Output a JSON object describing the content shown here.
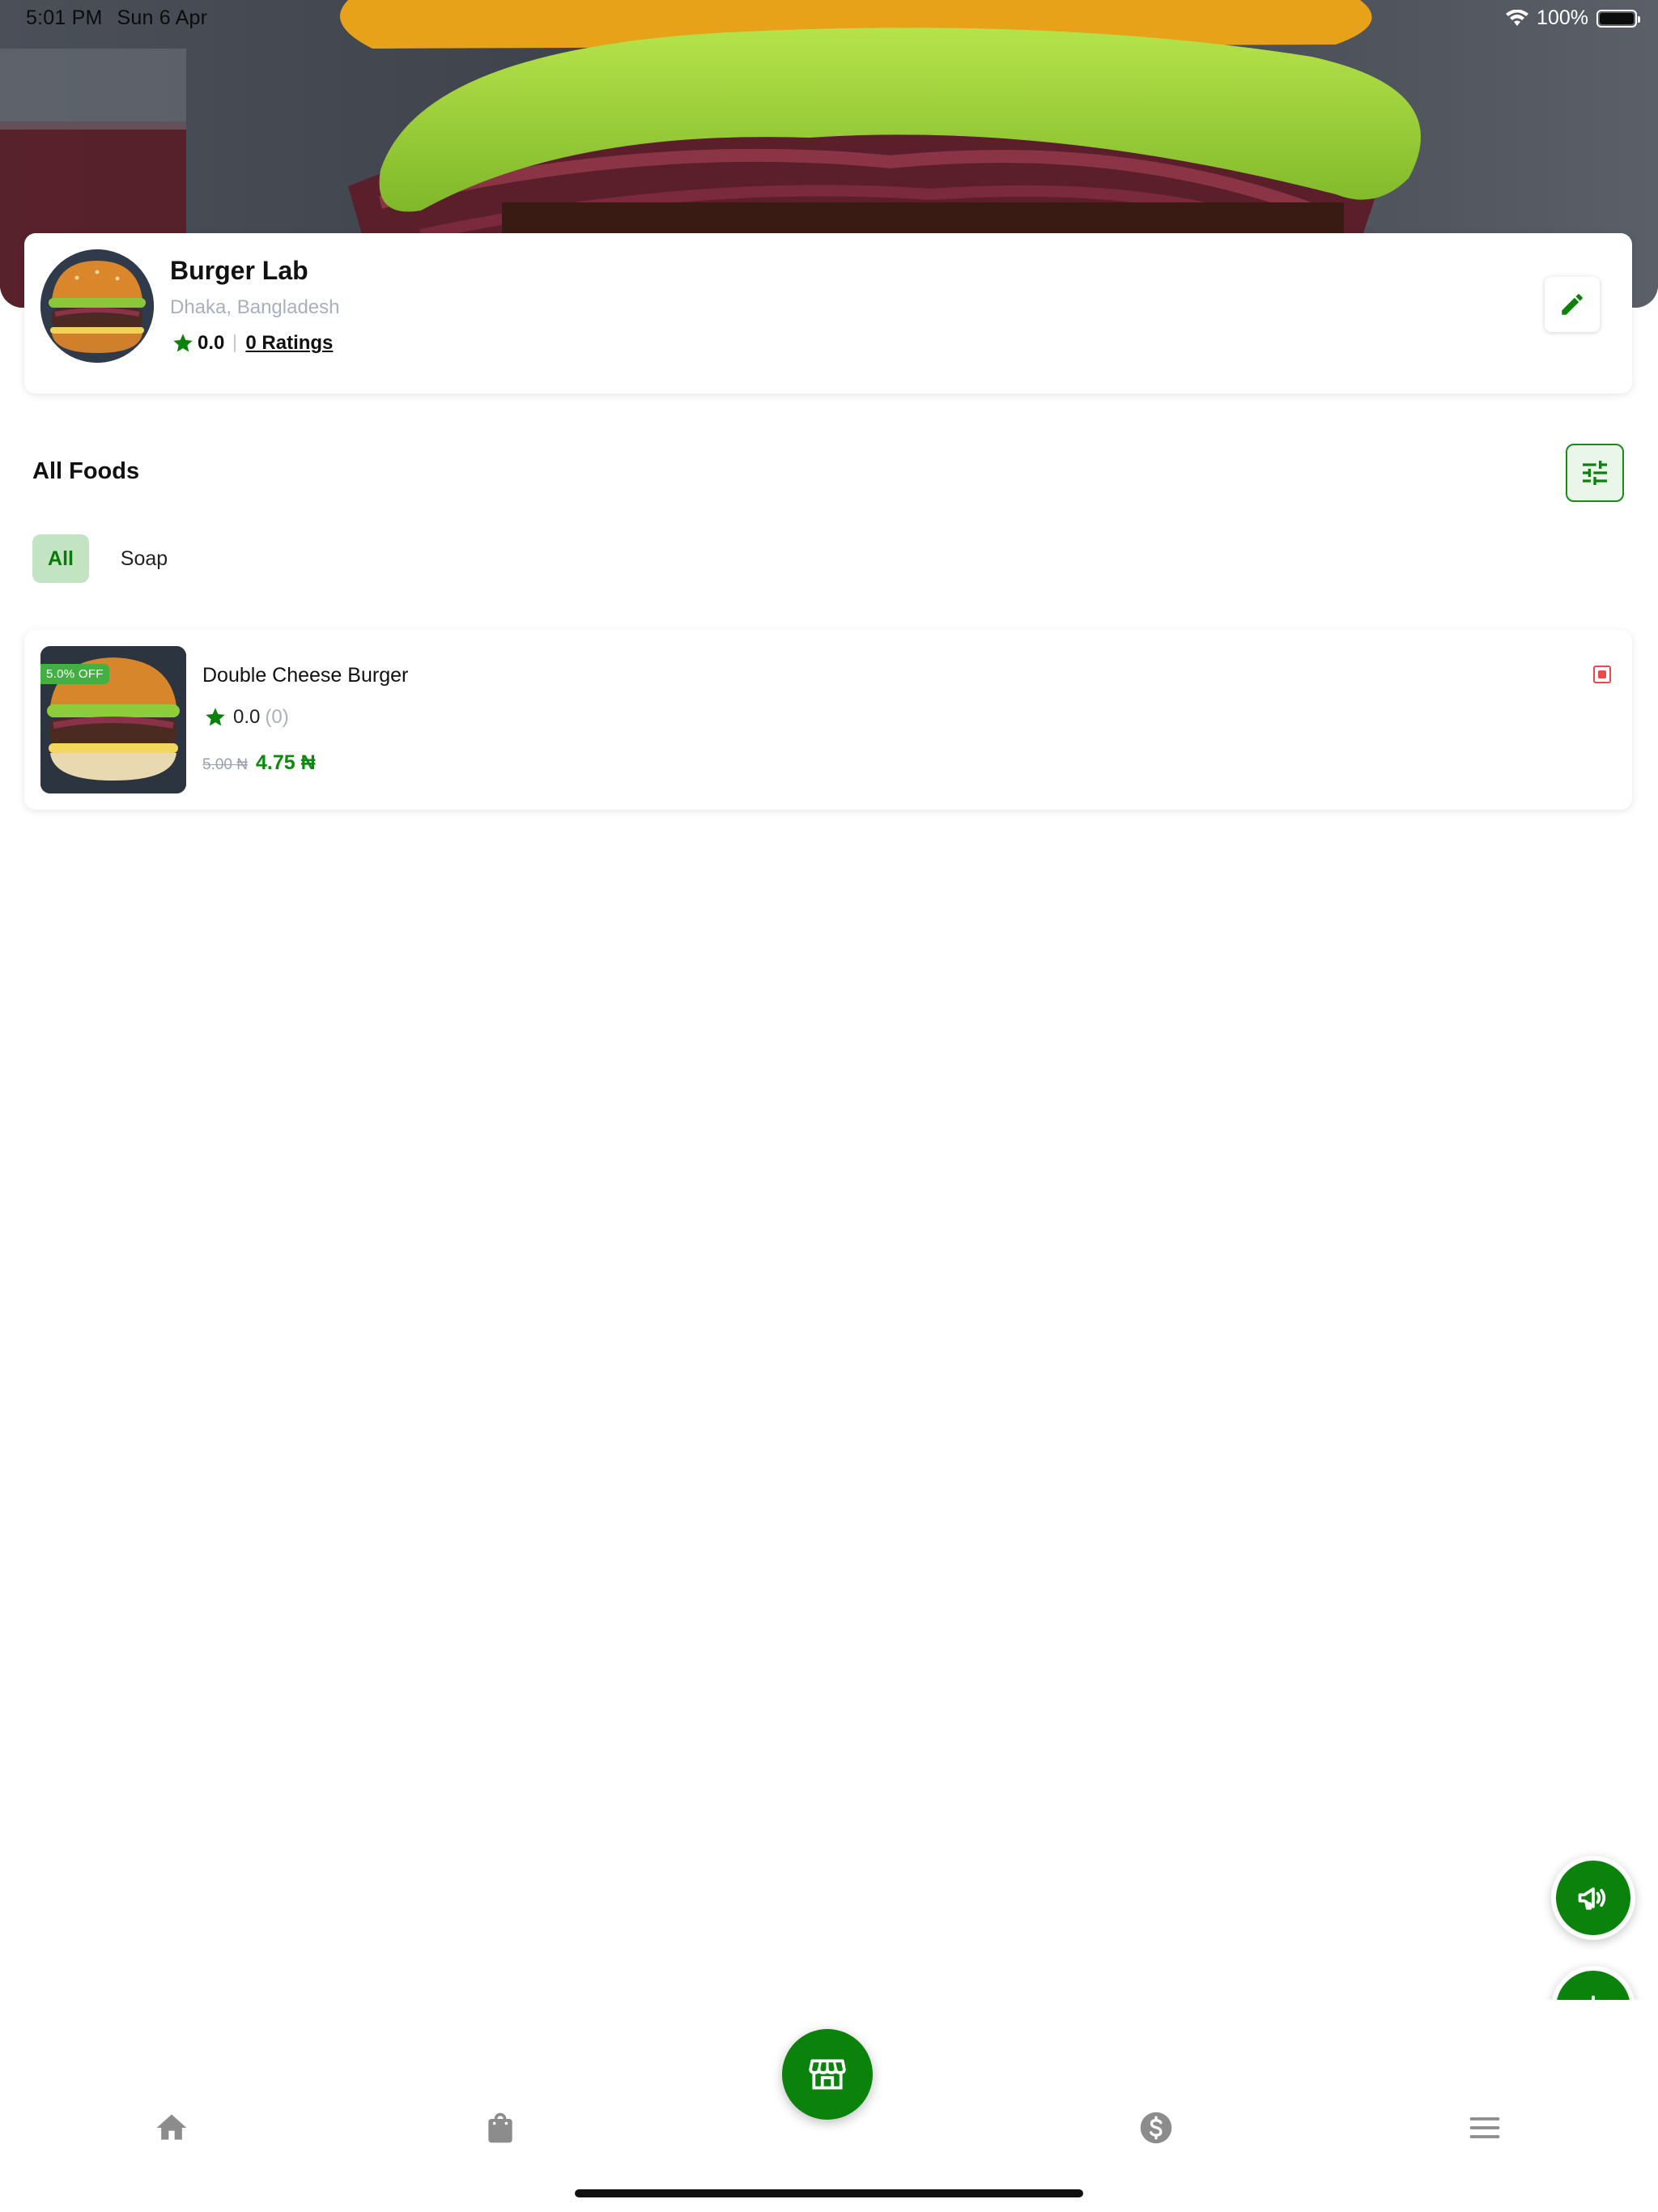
{
  "status_bar": {
    "time": "5:01 PM",
    "date": "Sun 6 Apr",
    "battery": "100%"
  },
  "restaurant": {
    "name": "Burger Lab",
    "location": "Dhaka, Bangladesh",
    "rating": "0.0",
    "ratings_link": "0 Ratings"
  },
  "section": {
    "title": "All Foods"
  },
  "categories": [
    {
      "label": "All",
      "selected": true
    },
    {
      "label": "Soap",
      "selected": false
    }
  ],
  "foods": [
    {
      "name": "Double Cheese Burger",
      "discount": "5.0% OFF",
      "rating": "0.0",
      "rating_count": "(0)",
      "old_price": "5.00 ₦",
      "new_price": "4.75 ₦"
    }
  ],
  "colors": {
    "accent": "#0b820b",
    "chip_bg": "#c3e4c3",
    "veg_indicator": "#e84a4a",
    "muted_text": "#a9b0bc"
  },
  "icons": {
    "edit": "pencil-icon",
    "filter": "sliders-icon",
    "campaign": "megaphone-icon",
    "add": "plus-icon",
    "nav": [
      "home-icon",
      "shopping-bag-icon",
      "store-icon",
      "dollar-icon",
      "menu-icon"
    ]
  }
}
